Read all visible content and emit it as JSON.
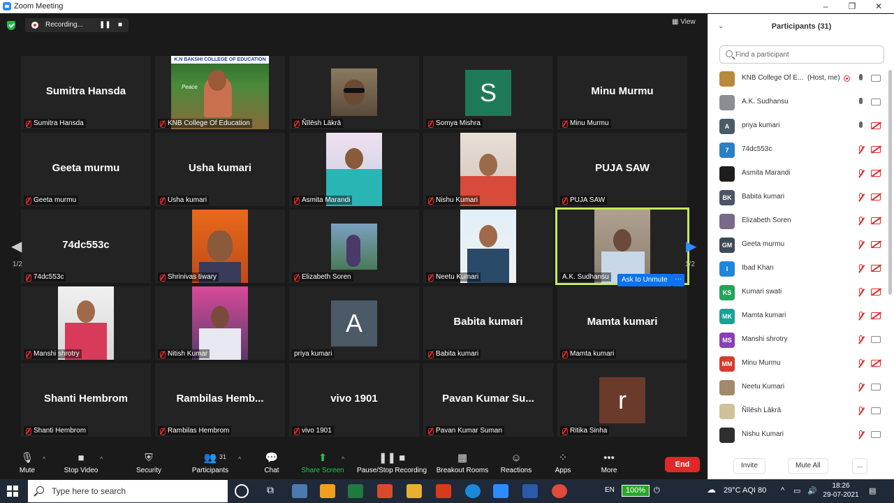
{
  "window": {
    "title": "Zoom Meeting",
    "minimize": "–",
    "maximize": "❐",
    "close": "✕"
  },
  "top": {
    "recording_label": "Recording...",
    "pause": "❚❚",
    "stop": "■",
    "view_label": "View"
  },
  "nav": {
    "page_left": "1/2",
    "page_right": "1/2",
    "prev": "◀",
    "next": "▶"
  },
  "tiles": [
    {
      "big": "Sumitra Hansda",
      "name": "Sumitra Hansda"
    },
    {
      "big": "",
      "name": "KNB College Of Education",
      "banner": "K.N BAKSHI COLLEGE OF EDUCATION",
      "banner_sub": "Peace"
    },
    {
      "big": "",
      "name": "Ñīlēsh Lākrā"
    },
    {
      "big": "",
      "name": "Somya Mishra",
      "letter": "S"
    },
    {
      "big": "Minu Murmu",
      "name": "Minu Murmu"
    },
    {
      "big": "Geeta murmu",
      "name": "Geeta murmu"
    },
    {
      "big": "Usha kumari",
      "name": "Usha kumari"
    },
    {
      "big": "",
      "name": "Asmita Marandi"
    },
    {
      "big": "",
      "name": "Nishu Kumari"
    },
    {
      "big": "PUJA SAW",
      "name": "PUJA SAW"
    },
    {
      "big": "74dc553c",
      "name": "74dc553c"
    },
    {
      "big": "",
      "name": "Shrinivas tiwary"
    },
    {
      "big": "",
      "name": "Elizabeth Soren"
    },
    {
      "big": "",
      "name": "Neetu Kumari"
    },
    {
      "big": "",
      "name": "A.K. Sudhansu"
    },
    {
      "big": "",
      "name": "Manshi shrotry"
    },
    {
      "big": "",
      "name": "Nitish Kumar"
    },
    {
      "big": "",
      "name": "priya kumari",
      "letter": "A"
    },
    {
      "big": "Babita kumari",
      "name": "Babita kumari"
    },
    {
      "big": "Mamta kumari",
      "name": "Mamta kumari"
    },
    {
      "big": "Shanti Hembrom",
      "name": "Shanti Hembrom"
    },
    {
      "big": "Rambilas  Hemb...",
      "name": "Rambilas Hembrom"
    },
    {
      "big": "vivo 1901",
      "name": "vivo 1901"
    },
    {
      "big": "Pavan  Kumar Su...",
      "name": "Pavan Kumar Suman"
    },
    {
      "big": "",
      "name": "Ritika Sinha",
      "letter": "r"
    }
  ],
  "ask_unmute": {
    "label": "Ask to Unmute",
    "more": "···"
  },
  "toolbar": {
    "mute": "Mute",
    "stop_video": "Stop Video",
    "security": "Security",
    "participants": "Participants",
    "participants_count": "31",
    "chat": "Chat",
    "share_screen": "Share Screen",
    "pause_stop_recording": "Pause/Stop Recording",
    "breakout_rooms": "Breakout Rooms",
    "reactions": "Reactions",
    "apps": "Apps",
    "more": "More",
    "end": "End",
    "caret": "^"
  },
  "panel": {
    "title": "Participants (31)",
    "chevron": "⌄",
    "search_placeholder": "Find a participant",
    "participants": [
      {
        "name": "KNB College Of E...",
        "tag": "(Host, me)",
        "initials": "",
        "color": "#b98a3c",
        "mic": "on",
        "cam": "on",
        "rec": true
      },
      {
        "name": "A.K. Sudhansu",
        "initials": "",
        "color": "#8a8f96",
        "mic": "on",
        "cam": "on"
      },
      {
        "name": "priya kumari",
        "initials": "A",
        "color": "#4a5a66",
        "mic": "on",
        "cam": "off"
      },
      {
        "name": "74dc553c",
        "initials": "7",
        "color": "#2a7fc4",
        "mic": "off",
        "cam": "off"
      },
      {
        "name": "Asmita Marandi",
        "initials": "",
        "color": "#1d1d1d",
        "mic": "off",
        "cam": "off"
      },
      {
        "name": "Babita kumari",
        "initials": "BK",
        "color": "#4b5563",
        "mic": "off",
        "cam": "off"
      },
      {
        "name": "Elizabeth Soren",
        "initials": "",
        "color": "#7a6a8a",
        "mic": "off",
        "cam": "off"
      },
      {
        "name": "Geeta murmu",
        "initials": "GM",
        "color": "#3f4a57",
        "mic": "off",
        "cam": "off"
      },
      {
        "name": "Ibad Khan",
        "initials": "I",
        "color": "#1f86e0",
        "mic": "off",
        "cam": "off"
      },
      {
        "name": "Kumari swati",
        "initials": "KS",
        "color": "#22a45a",
        "mic": "off",
        "cam": "off"
      },
      {
        "name": "Mamta kumari",
        "initials": "MK",
        "color": "#15a39a",
        "mic": "off",
        "cam": "off"
      },
      {
        "name": "Manshi shrotry",
        "initials": "MS",
        "color": "#8b3fb5",
        "mic": "off",
        "cam": "on"
      },
      {
        "name": "Minu Murmu",
        "initials": "MM",
        "color": "#d83a2b",
        "mic": "off",
        "cam": "off"
      },
      {
        "name": "Neetu Kumari",
        "initials": "",
        "color": "#a08a6a",
        "mic": "off",
        "cam": "on"
      },
      {
        "name": "Ñīlēsh Lākrā",
        "initials": "",
        "color": "#cfc29a",
        "mic": "off",
        "cam": "on"
      },
      {
        "name": "Nishu Kumari",
        "initials": "",
        "color": "#2f2f2f",
        "mic": "off",
        "cam": "on"
      }
    ],
    "invite": "Invite",
    "mute_all": "Mute All",
    "more": "..."
  },
  "taskbar": {
    "search_text": "Type here to search",
    "lang": "EN",
    "battery": "100%",
    "weather": "29°C  AQI 80",
    "time": "18:26",
    "date": "29-07-2021",
    "caret": "^"
  }
}
